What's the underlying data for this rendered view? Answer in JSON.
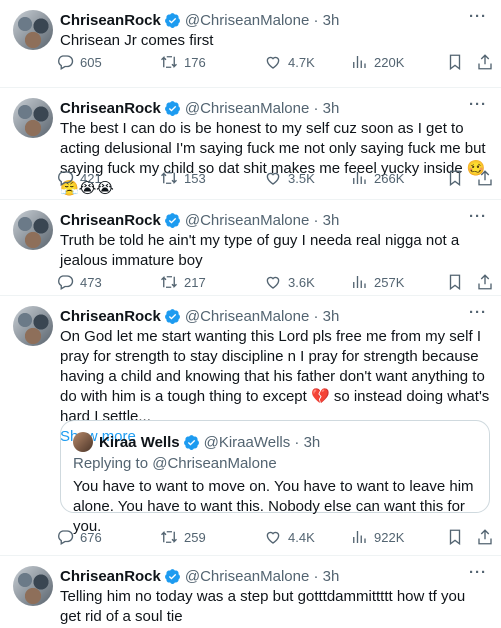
{
  "tweets": [
    {
      "name": "ChriseanRock",
      "handle": "@ChriseanMalone · 3h",
      "text": "Chrisean Jr comes first",
      "replies": "605",
      "retweets": "176",
      "likes": "4.7K",
      "views": "220K"
    },
    {
      "name": "ChriseanRock",
      "handle": "@ChriseanMalone · 3h",
      "text": "The best I can do is be honest to my self cuz soon as I get to acting delusional I'm saying fuck me not only saying fuck me but saying fuck my child so dat shit makes me feeel yucky inside",
      "emojis": [
        "🥴",
        "😤",
        "😭",
        "😭"
      ],
      "replies": "421",
      "retweets": "153",
      "likes": "3.5K",
      "views": "266K"
    },
    {
      "name": "ChriseanRock",
      "handle": "@ChriseanMalone · 3h",
      "text": "Truth be told he ain't my type  of guy I needa real nigga not a jealous immature boy",
      "replies": "473",
      "retweets": "217",
      "likes": "3.6K",
      "views": "257K"
    },
    {
      "name": "ChriseanRock",
      "handle": "@ChriseanMalone · 3h",
      "text": "On God let me start wanting this Lord pls free me from my self I pray for strength to stay discipline n I pray for strength because having a child and knowing that his father don't want anything to do with him is a tough thing to except",
      "text_after_emoji": " so instead doing what's hard I settle...",
      "emoji": "💔",
      "show_more": "Show more",
      "quote": {
        "name": "Kiraa Wells",
        "handle": "@KiraaWells · 3h",
        "replying": "Replying to @ChriseanMalone",
        "text": "You have to want to move on. You have to want to leave him alone. You have to want this. Nobody else can want this for you."
      },
      "replies": "676",
      "retweets": "259",
      "likes": "4.4K",
      "views": "922K"
    },
    {
      "name": "ChriseanRock",
      "handle": "@ChriseanMalone · 3h",
      "text": "Telling him no today was a step but gotttdammittttt how tf you get rid of a soul tie"
    }
  ],
  "more_label": "···",
  "colors": {
    "verified": "#1d9bf0",
    "muted": "#536471",
    "link": "#1d9bf0"
  }
}
